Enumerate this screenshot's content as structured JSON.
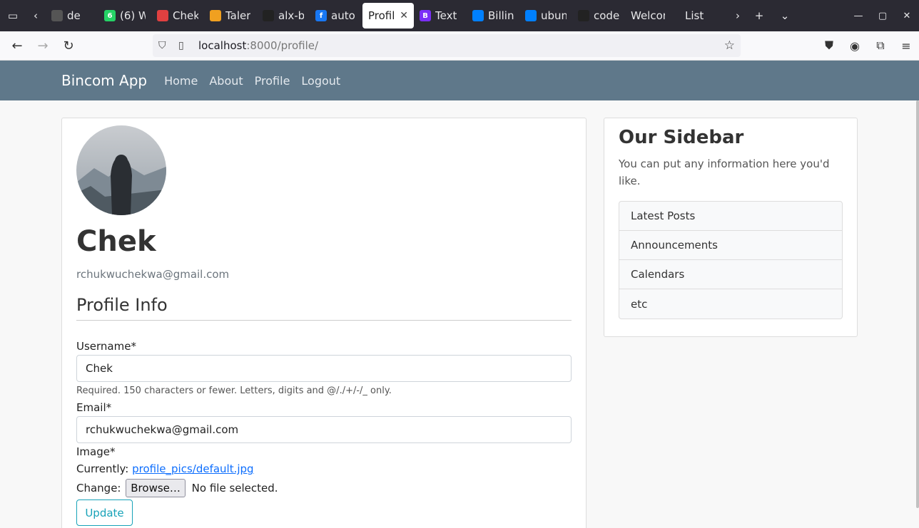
{
  "browser": {
    "tabs": [
      {
        "label": "de",
        "color": "#555555",
        "glyph": ""
      },
      {
        "label": "(6) W",
        "color": "#25d366",
        "glyph": "6"
      },
      {
        "label": "Chek",
        "color": "#e04040",
        "glyph": ""
      },
      {
        "label": "Taler",
        "color": "#f0a020",
        "glyph": ""
      },
      {
        "label": "alx-b",
        "color": "#222222",
        "glyph": ""
      },
      {
        "label": "auto",
        "color": "#1877f2",
        "glyph": "f"
      },
      {
        "label": "Profile",
        "color": "",
        "glyph": "",
        "active": true
      },
      {
        "label": "Text",
        "color": "#7b2ff7",
        "glyph": "B"
      },
      {
        "label": "Billin",
        "color": "#0080ff",
        "glyph": ""
      },
      {
        "label": "ubun",
        "color": "#0080ff",
        "glyph": ""
      },
      {
        "label": "code",
        "color": "#222222",
        "glyph": ""
      },
      {
        "label": "Welcom",
        "color": "",
        "glyph": ""
      },
      {
        "label": "List",
        "color": "",
        "glyph": ""
      }
    ],
    "url_host": "localhost",
    "url_path": ":8000/profile/"
  },
  "site": {
    "brand": "Bincom App",
    "nav": [
      "Home",
      "About",
      "Profile",
      "Logout"
    ]
  },
  "profile": {
    "username": "Chek",
    "email": "rchukwuchekwa@gmail.com",
    "section_title": "Profile Info",
    "username_label": "Username*",
    "username_value": "Chek",
    "username_help": "Required. 150 characters or fewer. Letters, digits and @/./+/-/_ only.",
    "email_label": "Email*",
    "email_value": "rchukwuchekwa@gmail.com",
    "image_label": "Image*",
    "currently_label": "Currently:",
    "current_file": "profile_pics/default.jpg",
    "change_label": "Change:",
    "browse_label": "Browse…",
    "no_file": "No file selected.",
    "update_label": "Update"
  },
  "sidebar": {
    "title": "Our Sidebar",
    "text": "You can put any information here you'd like.",
    "items": [
      "Latest Posts",
      "Announcements",
      "Calendars",
      "etc"
    ]
  }
}
